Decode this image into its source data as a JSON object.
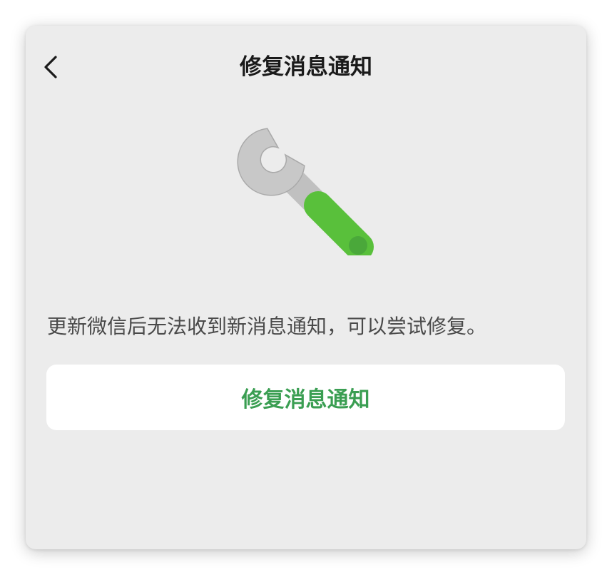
{
  "header": {
    "title": "修复消息通知"
  },
  "icons": {
    "back": "chevron-left-icon",
    "illustration": "wrench-icon"
  },
  "colors": {
    "background": "#ececec",
    "accent_green": "#5bc43d",
    "button_text": "#3a9e52",
    "wrench_metal": "#c4c4c4"
  },
  "main": {
    "description": "更新微信后无法收到新消息通知，可以尝试修复。",
    "repair_button_label": "修复消息通知"
  }
}
